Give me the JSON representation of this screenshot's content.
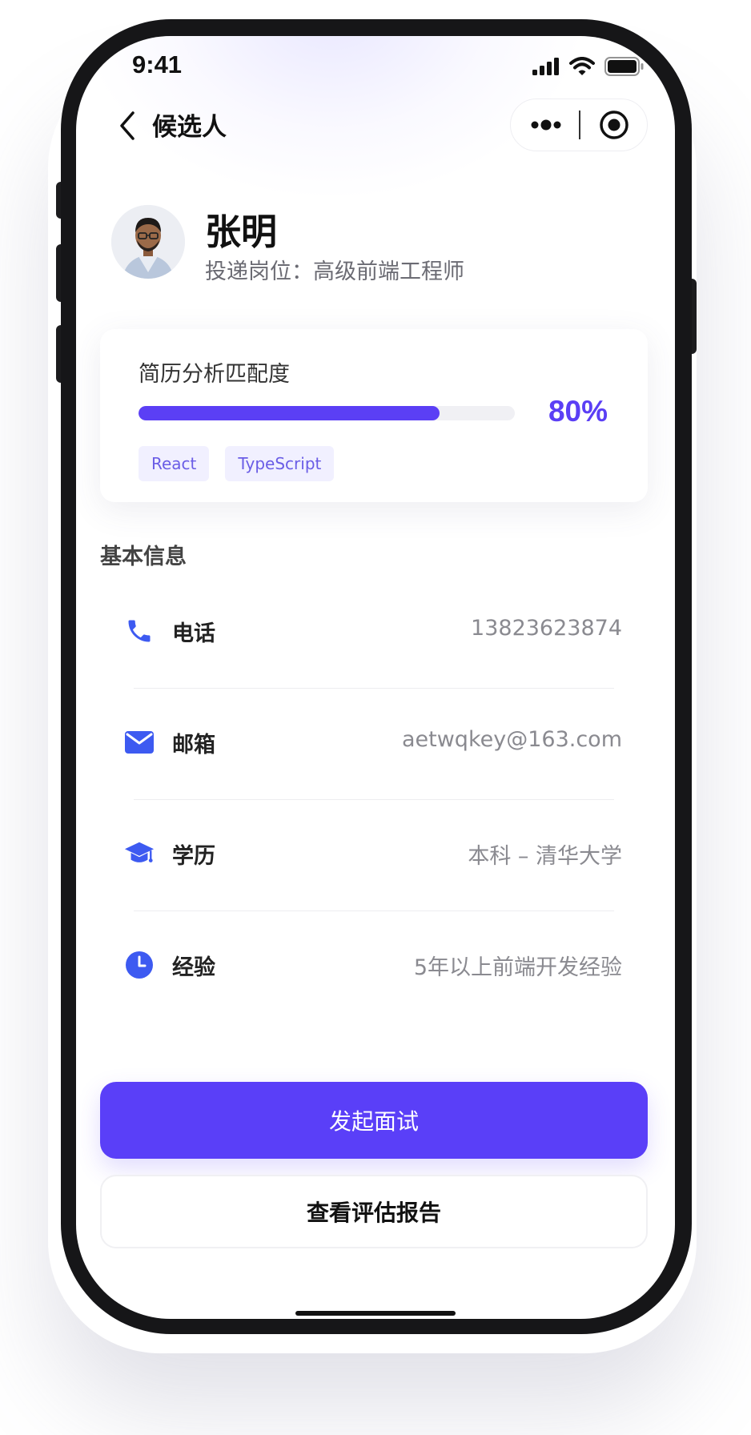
{
  "status_bar": {
    "time": "9:41"
  },
  "nav": {
    "title": "候选人"
  },
  "candidate": {
    "name": "张明",
    "position": "投递岗位：高级前端工程师"
  },
  "match": {
    "title": "简历分析匹配度",
    "percent_text": "80%",
    "percent": 80,
    "tags": [
      "React",
      "TypeScript"
    ]
  },
  "basic_info": {
    "title": "基本信息",
    "rows": [
      {
        "icon": "phone-icon",
        "label": "电话",
        "value": "13823623874"
      },
      {
        "icon": "mail-icon",
        "label": "邮箱",
        "value": "aetwqkey@163.com"
      },
      {
        "icon": "graduation-cap-icon",
        "label": "学历",
        "value": "本科 – 清华大学"
      },
      {
        "icon": "clock-icon",
        "label": "经验",
        "value": "5年以上前端开发经验"
      }
    ]
  },
  "actions": {
    "primary_label": "发起面试",
    "secondary_label": "查看评估报告"
  },
  "colors": {
    "accent": "#5b3ff5",
    "icon_blue": "#3d5af1",
    "tag_bg": "#f1f0ff",
    "frame": "#161618"
  }
}
